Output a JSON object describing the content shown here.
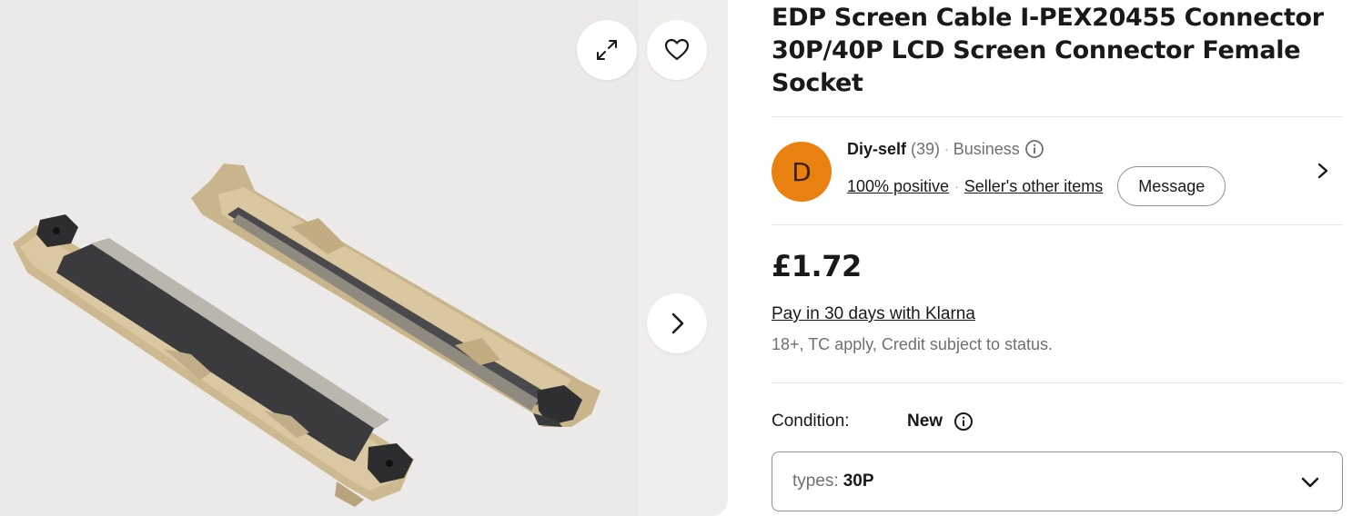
{
  "gallery": {
    "image_alt": "EDP connector product photo",
    "expand_icon": "expand-arrows-icon",
    "favorite_icon": "heart-icon",
    "next_icon": "chevron-right-icon"
  },
  "listing": {
    "title": "EDP Screen Cable I-PEX20455 Connector 30P/40P LCD Screen Connector Female Socket"
  },
  "seller": {
    "avatar_letter": "D",
    "name": "Diy-self",
    "feedback_count": "(39)",
    "separator": "·",
    "type": "Business",
    "positive": "100% positive",
    "other_items": "Seller's other items",
    "message_label": "Message",
    "avatar_color": "#e8810f"
  },
  "price": {
    "amount": "£1.72",
    "klarna": "Pay in 30 days with Klarna",
    "klarna_note": "18+, TC apply, Credit subject to status."
  },
  "condition": {
    "label": "Condition:",
    "value": "New"
  },
  "variation": {
    "label": "types:",
    "value": "30P"
  }
}
